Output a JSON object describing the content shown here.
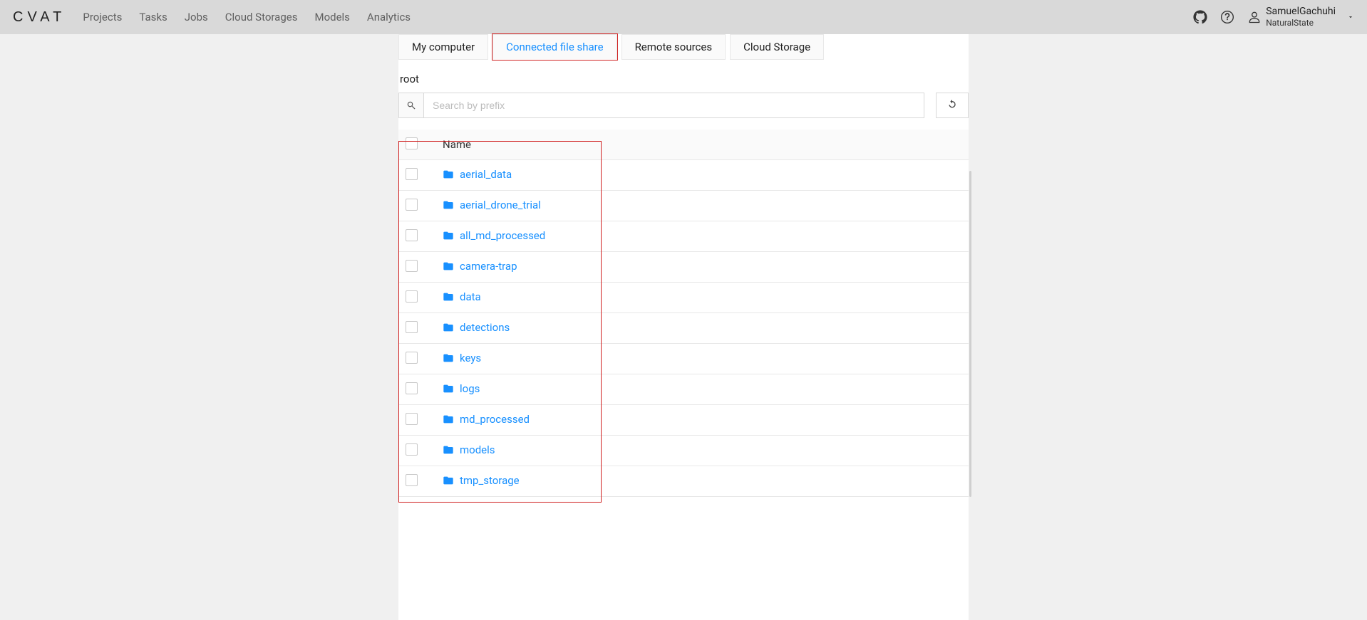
{
  "header": {
    "logo": "CVAT",
    "nav": [
      {
        "label": "Projects"
      },
      {
        "label": "Tasks"
      },
      {
        "label": "Jobs"
      },
      {
        "label": "Cloud Storages"
      },
      {
        "label": "Models"
      },
      {
        "label": "Analytics"
      }
    ],
    "user_name": "SamuelGachuhi",
    "user_org": "NaturalState"
  },
  "tabs": [
    {
      "label": "My computer",
      "active": false
    },
    {
      "label": "Connected file share",
      "active": true
    },
    {
      "label": "Remote sources",
      "active": false
    },
    {
      "label": "Cloud Storage",
      "active": false
    }
  ],
  "breadcrumb": "root",
  "search_placeholder": "Search by prefix",
  "columns": {
    "name": "Name"
  },
  "rows": [
    {
      "name": "aerial_data"
    },
    {
      "name": "aerial_drone_trial"
    },
    {
      "name": "all_md_processed"
    },
    {
      "name": "camera-trap"
    },
    {
      "name": "data"
    },
    {
      "name": "detections"
    },
    {
      "name": "keys"
    },
    {
      "name": "logs"
    },
    {
      "name": "md_processed"
    },
    {
      "name": "models"
    },
    {
      "name": "tmp_storage"
    }
  ]
}
